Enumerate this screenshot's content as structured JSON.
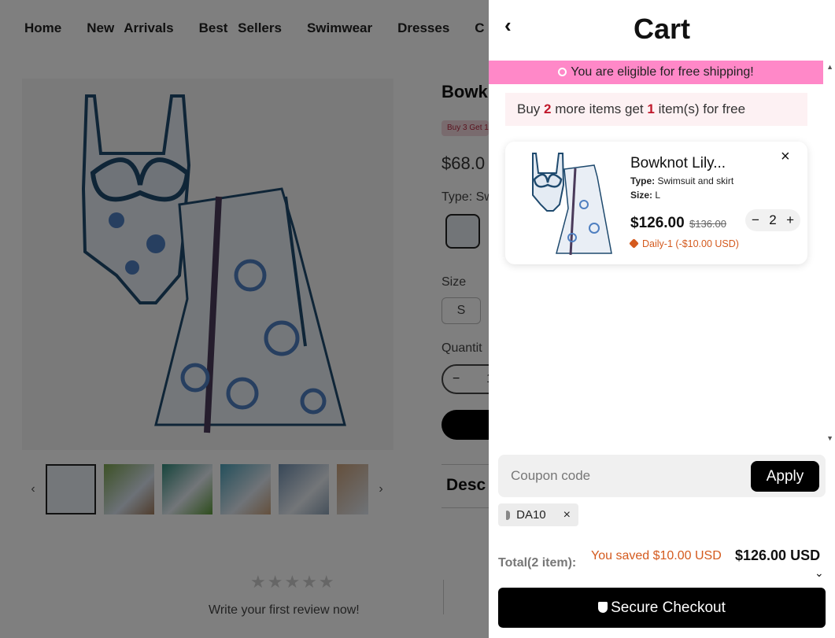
{
  "nav": [
    "Home",
    "New Arrivals",
    "Best Sellers",
    "Swimwear",
    "Dresses",
    "C"
  ],
  "product": {
    "title": "Bowk",
    "promo": "Buy 3 Get 1",
    "price": "$68.0",
    "type_label": "Type: Sw",
    "size_label": "Size",
    "size_option": "S",
    "quantity_label": "Quantit",
    "quantity_minus": "−",
    "quantity_value": "1",
    "description_label": "Desc",
    "review_cta": "Write your first review now!",
    "stars": "★★★★★",
    "thumb_prev": "‹",
    "thumb_next": "›"
  },
  "cart": {
    "title": "Cart",
    "back_icon": "‹",
    "shipping_banner": "You are eligible for free shipping!",
    "bogo": {
      "pre": "Buy ",
      "n1": "2",
      "mid": " more items get ",
      "n2": "1",
      "post": " item(s) for free"
    },
    "item": {
      "name": "Bowknot Lily...",
      "type_label": "Type:",
      "type_value": "Swimsuit and skirt",
      "size_label": "Size:",
      "size_value": "L",
      "price": "$126.00",
      "compare_price": "$136.00",
      "quantity": "2",
      "minus": "−",
      "plus": "+",
      "remove": "×",
      "discount": "Daily-1 (-$10.00 USD)"
    },
    "coupon_placeholder": "Coupon code",
    "apply_label": "Apply",
    "applied_code": "DA10",
    "applied_code_remove": "×",
    "total_label": "Total(2 item):",
    "saved_text": "You saved $10.00 USD",
    "total_value": "$126.00 USD",
    "total_chevron": "⌄",
    "checkout_label": "Secure Checkout",
    "scroll_up": "▲",
    "scroll_down": "▼"
  },
  "colors": {
    "banner": "#ff88c8",
    "bogo_bg": "#fdf1f3",
    "bogo_accent": "#c0182b",
    "discount": "#d45a1e",
    "button": "#000000"
  },
  "icons": [
    "chevron-left-icon",
    "close-icon",
    "tag-icon",
    "shield-check-icon",
    "chevron-down-icon",
    "star-icon"
  ]
}
